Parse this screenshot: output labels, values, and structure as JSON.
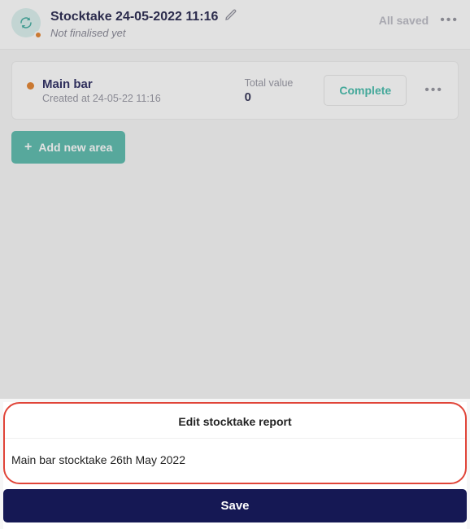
{
  "header": {
    "title": "Stocktake 24-05-2022 11:16",
    "subtitle": "Not finalised yet",
    "allsaved": "All saved"
  },
  "area": {
    "name": "Main bar",
    "created": "Created at 24-05-22 11:16",
    "total_label": "Total value",
    "total_value": "0",
    "complete_label": "Complete"
  },
  "add_area_label": "Add new area",
  "modal": {
    "title": "Edit stocktake report",
    "input_value": "Main bar stocktake 26th May 2022",
    "save_label": "Save"
  }
}
